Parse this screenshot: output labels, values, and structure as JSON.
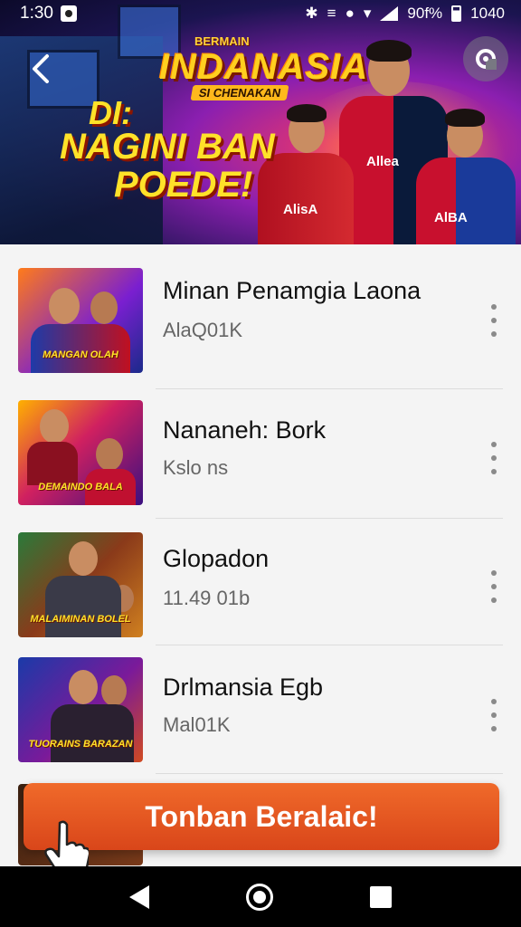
{
  "status_bar": {
    "time": "1:30",
    "right_text": "90f%",
    "clock_right": "1040"
  },
  "banner": {
    "logo_sup": "BERMAIN",
    "logo_title": "INDANASIA",
    "logo_sub": "SI CHENAKAN",
    "promo_line1": "DI:",
    "promo_line2": "NAGINI BAN",
    "promo_line3": "POEDE!",
    "shirt_text_1": "AlisA",
    "shirt_text_2": "Allea",
    "shirt_text_3": "AlBA"
  },
  "list": {
    "items": [
      {
        "title": "Minan Penamgia Laona",
        "subtitle": "AlаQ01K",
        "thumb_caption": "MANGAN OLAH"
      },
      {
        "title": "Nananeh: Bork",
        "subtitle": "Kslo ns",
        "thumb_caption": "DEMAINDO BALA"
      },
      {
        "title": "Glopadon",
        "subtitle": "11.49 01b",
        "thumb_caption": "MALAIMINAN BOLEL"
      },
      {
        "title": "Drlmansia Egb",
        "subtitle": "Mal01K",
        "thumb_caption": "TUORAINS BARAZAN"
      }
    ]
  },
  "cta": {
    "label": "Tonban Beralaic!"
  },
  "colors": {
    "cta_top": "#f06a2a",
    "cta_bottom": "#d9461a",
    "promo_yellow": "#ffe229"
  }
}
